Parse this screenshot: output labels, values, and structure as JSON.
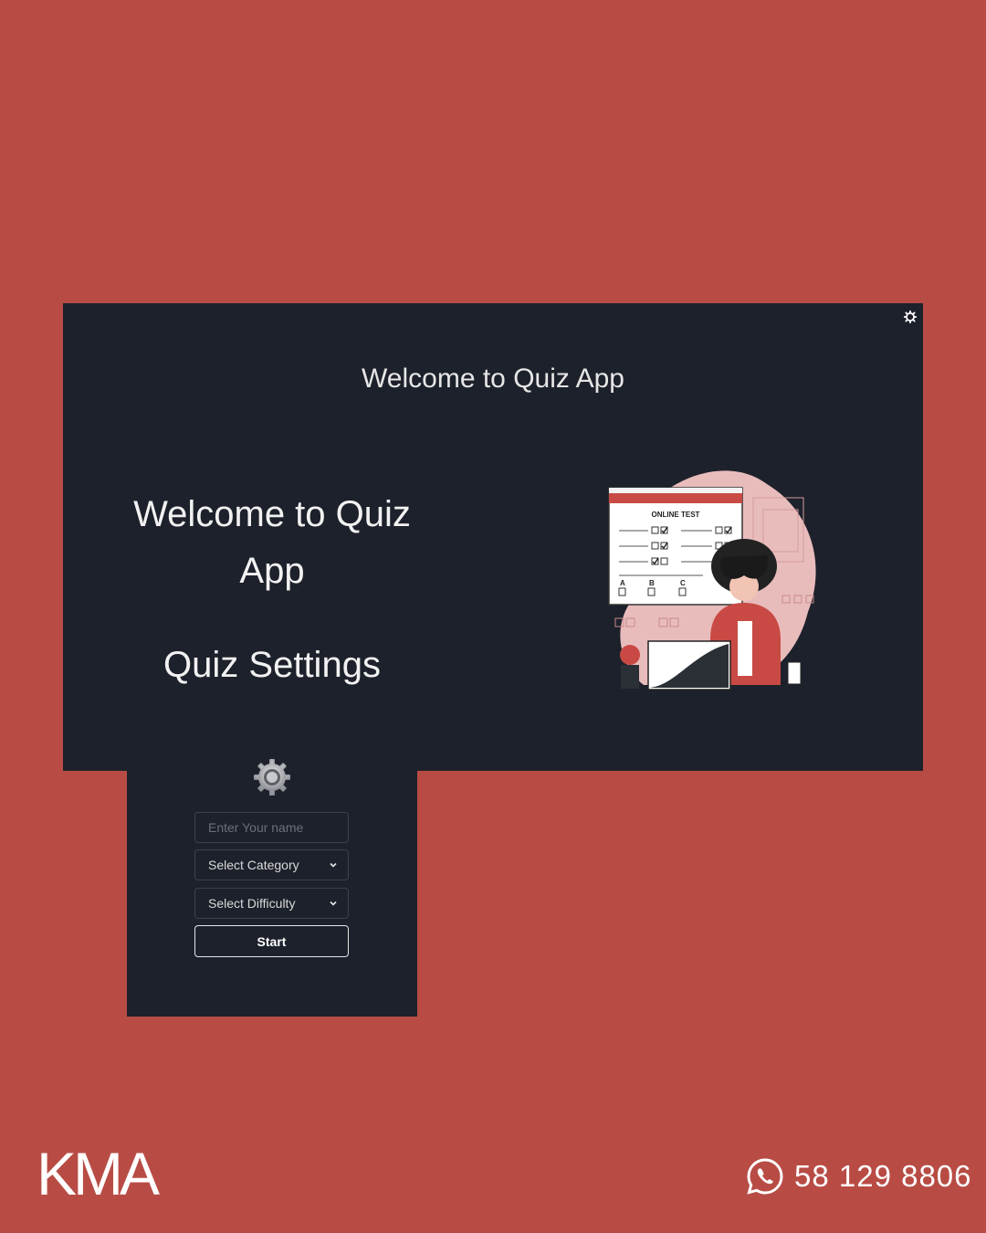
{
  "colors": {
    "background": "#b84c45",
    "panel": "#1d212b",
    "text": "#f2f2f2",
    "illustration_accent": "#c94a44",
    "illustration_blob": "#e9bcbc"
  },
  "app": {
    "header_title": "Welcome to Quiz App",
    "settings_icon": "gear-icon",
    "hero_title": "Welcome to Quiz App",
    "settings_title": "Quiz Settings",
    "settings_big_icon": "gear-icon"
  },
  "form": {
    "name_placeholder": "Enter Your name",
    "category_selected": "Select Category",
    "difficulty_selected": "Select Difficulty",
    "start_label": "Start"
  },
  "illustration": {
    "icon": "online-test-illustration",
    "window_title": "ONLINE TEST",
    "options": [
      "A",
      "B",
      "C"
    ]
  },
  "branding": {
    "logo_text": "KMA",
    "contact_icon": "whatsapp-icon",
    "phone": "58 129 8806"
  }
}
